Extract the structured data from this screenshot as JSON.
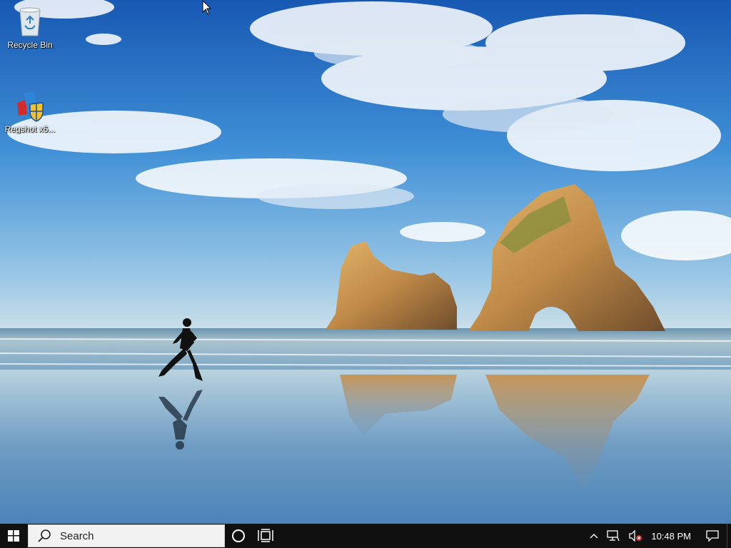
{
  "desktop": {
    "icons": [
      {
        "label": "Recycle Bin",
        "icon": "recycle-bin-icon"
      },
      {
        "label": "Regshot x6...",
        "icon": "regshot-icon"
      }
    ]
  },
  "taskbar": {
    "start_icon": "windows-logo-icon",
    "search_placeholder": "Search",
    "cortana_icon": "cortana-circle-icon",
    "task_view_icon": "task-view-icon",
    "tray": {
      "chevron_icon": "chevron-up-icon",
      "network_icon": "network-icon",
      "volume_icon": "volume-muted-icon",
      "clock": "10:48 PM",
      "notifications_icon": "action-center-icon"
    }
  },
  "colors": {
    "taskbar_bg": "#101010",
    "search_bg": "#f2f2f2",
    "sky_top": "#1d5fb8",
    "sea": "#5d8fb3"
  }
}
